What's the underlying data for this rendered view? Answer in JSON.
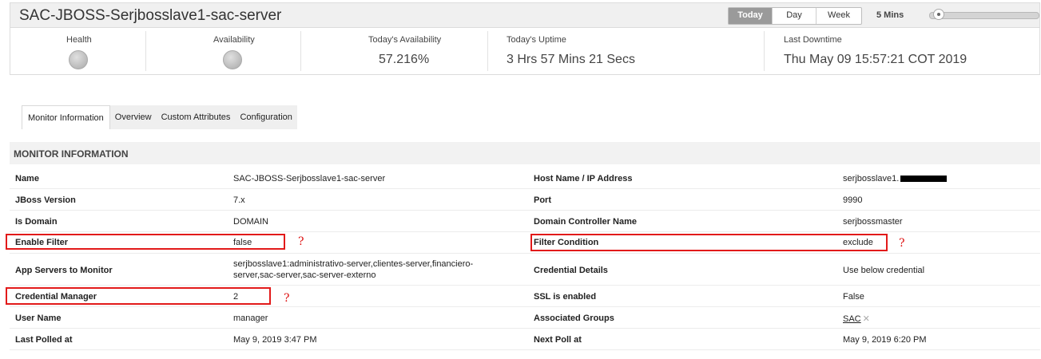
{
  "header": {
    "title": "SAC-JBOSS-Serjbosslave1-sac-server",
    "ranges": [
      "Today",
      "Day",
      "Week"
    ],
    "active_range": "Today",
    "interval": "5 Mins"
  },
  "stats": {
    "health_label": "Health",
    "availability_label": "Availability",
    "todays_availability_label": "Today's Availability",
    "todays_availability_value": "57.216%",
    "todays_uptime_label": "Today's Uptime",
    "todays_uptime_value": "3 Hrs 57 Mins 21 Secs",
    "last_downtime_label": "Last Downtime",
    "last_downtime_value": "Thu May 09 15:57:21 COT 2019"
  },
  "tabs": [
    "Monitor Information",
    "Overview",
    "Custom Attributes",
    "Configuration"
  ],
  "section_title": "MONITOR INFORMATION",
  "rows": [
    {
      "l1": "Name",
      "v1": "SAC-JBOSS-Serjbosslave1-sac-server",
      "l2": "Host Name / IP Address",
      "v2": "serjbosslave1."
    },
    {
      "l1": "JBoss Version",
      "v1": "7.x",
      "l2": "Port",
      "v2": "9990"
    },
    {
      "l1": "Is Domain",
      "v1": "DOMAIN",
      "l2": "Domain Controller Name",
      "v2": "serjbossmaster"
    },
    {
      "l1": "Enable Filter",
      "v1": "false",
      "l2": "Filter Condition",
      "v2": "exclude"
    },
    {
      "l1": "App Servers to Monitor",
      "v1a": "serjbosslave1:administrativo-server,clientes-server,financiero-",
      "v1b": "server,sac-server,sac-server-externo",
      "l2": "Credential Details",
      "v2": "Use below credential"
    },
    {
      "l1": "Credential Manager",
      "v1": "2",
      "l2": "SSL is enabled",
      "v2": "False"
    },
    {
      "l1": "User Name",
      "v1": "manager",
      "l2": "Associated Groups",
      "v2": "SAC"
    },
    {
      "l1": "Last Polled at",
      "v1": "May 9, 2019 3:47 PM",
      "l2": "Next Poll at",
      "v2": "May 9, 2019 6:20 PM"
    }
  ],
  "annotations": {
    "question_mark": "?"
  },
  "colors": {
    "highlight_box": "#e21a1a",
    "annotation": "#dd1111"
  }
}
